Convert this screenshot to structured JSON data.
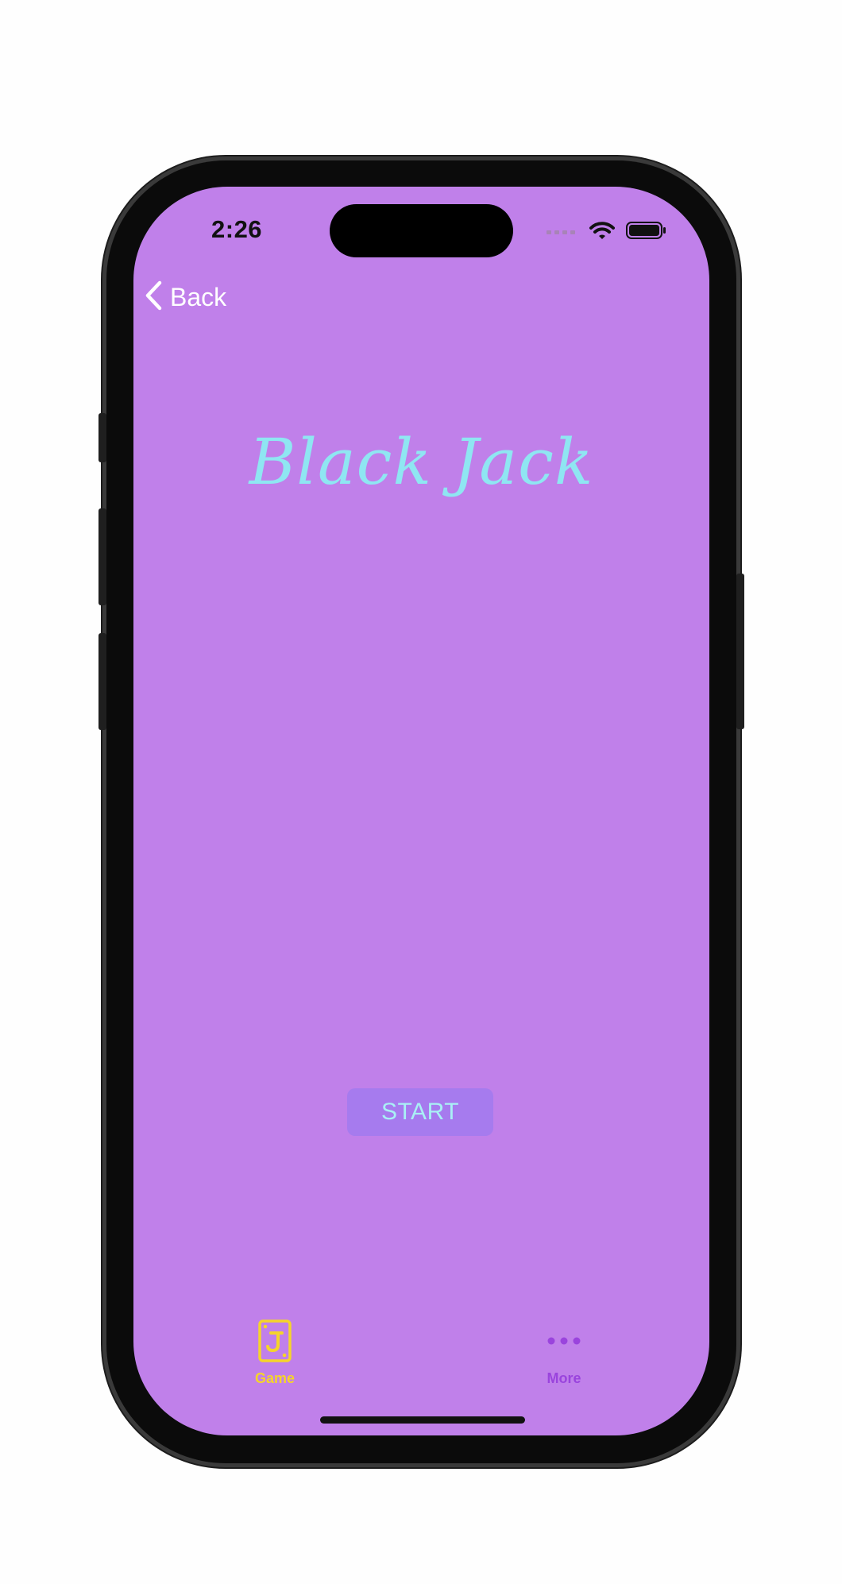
{
  "status_bar": {
    "time": "2:26"
  },
  "nav": {
    "back_label": "Back"
  },
  "main": {
    "title": "Black Jack",
    "start_label": "START"
  },
  "tab_bar": {
    "items": [
      {
        "label": "Game",
        "icon": "card-j-icon",
        "active": true,
        "color": "#f5d42a"
      },
      {
        "label": "More",
        "icon": "more-dots-icon",
        "active": false,
        "color": "#9a44dd"
      }
    ]
  },
  "colors": {
    "background": "#c080ea",
    "title": "#8fe6f2",
    "button_bg": "#a67bee",
    "button_text": "#a9f0f5"
  }
}
